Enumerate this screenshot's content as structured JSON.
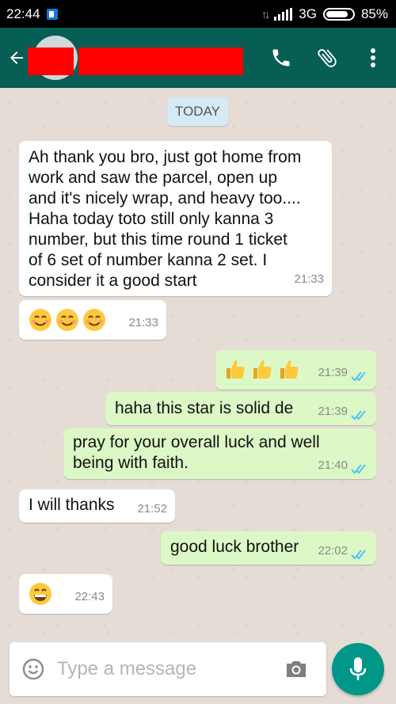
{
  "status_bar": {
    "time": "22:44",
    "network": "3G",
    "battery": "85%",
    "battery_level": 0.85
  },
  "app_bar": {
    "icons": [
      "back-arrow-icon",
      "phone-icon",
      "paperclip-icon",
      "more-vert-icon"
    ]
  },
  "chat": {
    "date_chip": "TODAY",
    "messages": [
      {
        "dir": "in",
        "lines": [
          "Ah thank you bro, just got home from",
          "work and saw the parcel, open up",
          "and it's nicely wrap, and heavy too....",
          "Haha today toto still only kanna 3",
          "number, but this time round 1 ticket",
          "of 6 set of number kanna 2 set. I",
          "consider it a good start"
        ],
        "time": "21:33"
      },
      {
        "dir": "in",
        "emoji": [
          "smiling-face-icon",
          "smiling-face-icon",
          "smiling-face-icon"
        ],
        "time": "21:33"
      },
      {
        "dir": "out",
        "emoji": [
          "thumbs-up-icon",
          "thumbs-up-icon",
          "thumbs-up-icon"
        ],
        "time": "21:39",
        "status": "read"
      },
      {
        "dir": "out",
        "text": "haha this star is solid de",
        "time": "21:39",
        "status": "read"
      },
      {
        "dir": "out",
        "lines": [
          "pray for your overall luck and well",
          "being with faith."
        ],
        "time": "21:40",
        "status": "read"
      },
      {
        "dir": "in",
        "text": "I will thanks",
        "time": "21:52"
      },
      {
        "dir": "out",
        "text": "good luck brother",
        "time": "22:02",
        "status": "read"
      },
      {
        "dir": "in",
        "emoji": [
          "grinning-face-icon"
        ],
        "time": "22:43"
      }
    ]
  },
  "composer": {
    "placeholder": "Type a message"
  },
  "colors": {
    "header": "#075e54",
    "incoming": "#ffffff",
    "outgoing": "#dcf8c6",
    "tick": "#4fc3f7",
    "mic": "#009688"
  }
}
